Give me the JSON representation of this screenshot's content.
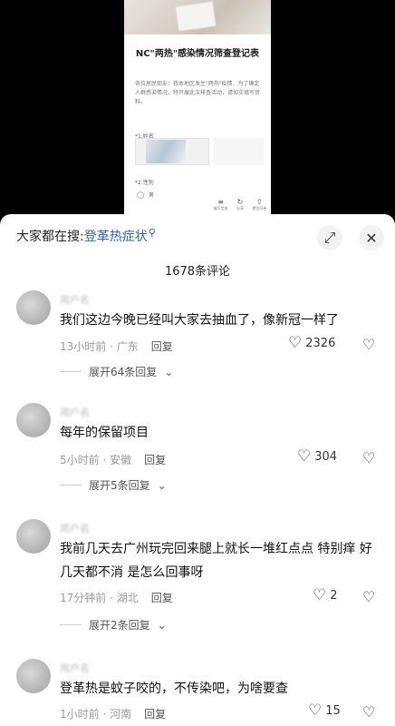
{
  "video": {
    "doc_title": "NC\"两热\"感染情况筛查登记表",
    "doc_intro": "各位居民朋友：我本地区发生\"两热\"疫情，为了确定人群感染情况，特开展此次排查活动，请如实填写资料。",
    "question_1": "*1.姓名",
    "question_2": "*2.性别",
    "option_male": "男",
    "toolbar": [
      {
        "icon": "≡",
        "label": "填写信息"
      },
      {
        "icon": "↻",
        "label": "分享"
      },
      {
        "icon": "⇧",
        "label": "提交问卷"
      }
    ]
  },
  "sheet": {
    "search_prefix": "大家都在搜: ",
    "search_term": "登革热症状",
    "expand_icon": "⤢",
    "close_icon": "✕",
    "comment_count": "1678条评论"
  },
  "comments": [
    {
      "username": "用户名",
      "text": "我们这边今晚已经叫大家去抽血了，像新冠一样了",
      "time": "13小时前 · 广东",
      "reply": "回复",
      "likes": "2326",
      "more": "展开64条回复"
    },
    {
      "username": "用户名",
      "text": "每年的保留项目",
      "time": "5小时前 · 安徽",
      "reply": "回复",
      "likes": "304",
      "more": "展开5条回复"
    },
    {
      "username": "用户名",
      "text": "我前几天去广州玩完回来腿上就长一堆红点点 特别痒 好几天都不消 是怎么回事呀",
      "time": "17分钟前 · 湖北",
      "reply": "回复",
      "likes": "2",
      "more": "展开2条回复"
    },
    {
      "username": "用户名",
      "text": "登革热是蚊子咬的，不传染吧，为啥要查",
      "time": "1小时前 · 河南",
      "reply": "回复",
      "likes": "15"
    }
  ]
}
